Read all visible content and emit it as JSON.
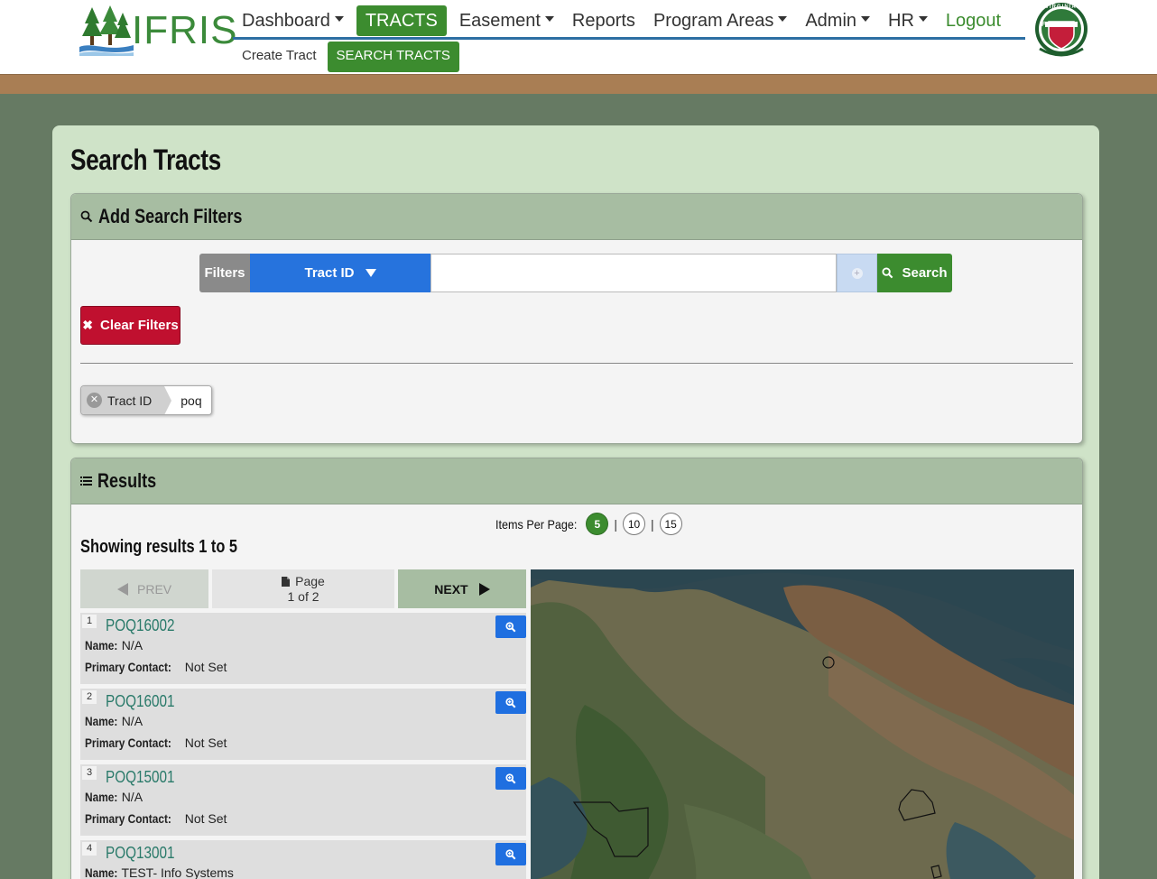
{
  "header": {
    "logo_text": "IFRIS",
    "nav": [
      {
        "label": "Dashboard"
      },
      {
        "label": "TRACTS"
      },
      {
        "label": "Easement"
      },
      {
        "label": "Reports"
      },
      {
        "label": "Program Areas"
      },
      {
        "label": "Admin"
      },
      {
        "label": "HR"
      },
      {
        "label": "Logout"
      }
    ],
    "subnav": [
      {
        "label": "Create Tract"
      },
      {
        "label": "SEARCH TRACTS"
      }
    ],
    "seal_top": "VIRGINIA",
    "seal_bottom": "FORESTRY",
    "brand_green": "#3c8c2f",
    "nav_underline": "#2d6fa3"
  },
  "page": {
    "title": "Search Tracts"
  },
  "filters_panel": {
    "title": "Add Search Filters",
    "filter_label": "Filters",
    "selected_filter": "Tract ID",
    "input_value": "",
    "search_label": "Search",
    "clear_label": "Clear Filters",
    "active_chip": {
      "field": "Tract ID",
      "value": "poq"
    }
  },
  "results_panel": {
    "title": "Results",
    "items_per_page_label": "Items Per Page:",
    "items_per_page_options": [
      "5",
      "10",
      "15"
    ],
    "items_per_page_selected": "5",
    "showing_text": "Showing results 1 to 5",
    "pager": {
      "prev_label": "PREV",
      "page_label": "Page",
      "page_of": "1 of 2",
      "next_label": "NEXT"
    },
    "name_label": "Name:",
    "contact_label": "Primary Contact:",
    "items": [
      {
        "num": "1",
        "id": "POQ16002",
        "name": "N/A",
        "contact": "Not Set"
      },
      {
        "num": "2",
        "id": "POQ16001",
        "name": "N/A",
        "contact": "Not Set"
      },
      {
        "num": "3",
        "id": "POQ15001",
        "name": "N/A",
        "contact": "Not Set"
      },
      {
        "num": "4",
        "id": "POQ13001",
        "name": "TEST- Info Systems",
        "contact": ""
      }
    ]
  }
}
